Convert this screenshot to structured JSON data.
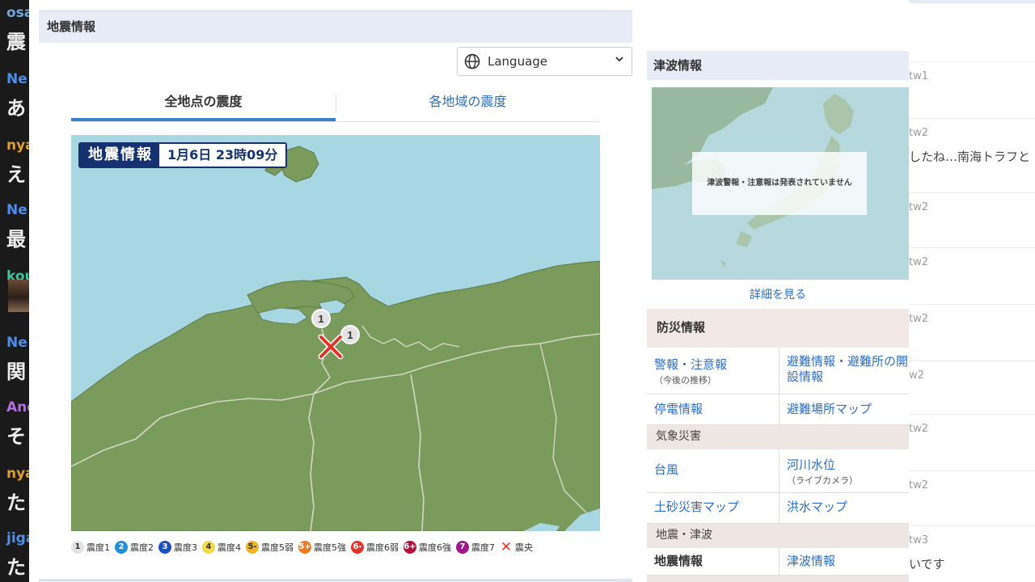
{
  "chat_left": {
    "messages": [
      {
        "name": "osa",
        "text": "震",
        "name_color": "#6fa8dc"
      },
      {
        "name": "Ne",
        "text": "あ",
        "name_color": "#4f8ee8"
      },
      {
        "name": "nya",
        "text": "え",
        "name_color": "#e0a030"
      },
      {
        "name": "Ne",
        "text": "最",
        "name_color": "#4f8ee8"
      },
      {
        "name": "kou",
        "text": "",
        "name_color": "#3cc49a",
        "avatar": true
      },
      {
        "name": "Ne",
        "text": "関",
        "name_color": "#4f8ee8"
      },
      {
        "name": "And",
        "text": "そ",
        "name_color": "#b070e0"
      },
      {
        "name": "nya",
        "text": "た",
        "name_color": "#e0a030"
      },
      {
        "name": "jiga",
        "text": "た",
        "name_color": "#4f8ee8"
      }
    ]
  },
  "chat_right": {
    "messages": [
      {
        "name": "tw1",
        "text": ""
      },
      {
        "name": "tw2",
        "text": "したね…南海トラフと"
      },
      {
        "name": "tw2",
        "text": ""
      },
      {
        "name": "tw2",
        "text": ""
      },
      {
        "name": "tw2",
        "text": ""
      },
      {
        "name": "w2",
        "text": ""
      },
      {
        "name": "tw2",
        "text": ""
      },
      {
        "name": "tw2",
        "text": ""
      },
      {
        "name": "tw3",
        "text": "いです"
      }
    ]
  },
  "main": {
    "header": "地震情報",
    "language_label": "Language",
    "tabs": [
      {
        "label": "全地点の震度",
        "active": true
      },
      {
        "label": "各地域の震度",
        "active": false
      }
    ],
    "map": {
      "badge_title": "地震情報",
      "badge_time": "1月6日 23時09分",
      "intensity_markers": [
        "1",
        "1"
      ],
      "colors": {
        "sea": "#a7d7e3",
        "land": "#7a9b5c",
        "border": "#d6d6c2",
        "epicenter": "#e0352b"
      }
    },
    "legend": [
      {
        "code": "1",
        "label": "震度1",
        "color": "#e3e3e3",
        "text_color": "#333333"
      },
      {
        "code": "2",
        "label": "震度2",
        "color": "#1f8fd8",
        "text_color": "#ffffff"
      },
      {
        "code": "3",
        "label": "震度3",
        "color": "#1d4fc2",
        "text_color": "#ffffff"
      },
      {
        "code": "4",
        "label": "震度4",
        "color": "#f2d84a",
        "text_color": "#333333"
      },
      {
        "code": "5-",
        "label": "震度5弱",
        "color": "#f0b323",
        "text_color": "#333333"
      },
      {
        "code": "5+",
        "label": "震度5強",
        "color": "#ec7a1e",
        "text_color": "#ffffff"
      },
      {
        "code": "6-",
        "label": "震度6弱",
        "color": "#e0352b",
        "text_color": "#ffffff"
      },
      {
        "code": "6+",
        "label": "震度6強",
        "color": "#b3123e",
        "text_color": "#ffffff"
      },
      {
        "code": "7",
        "label": "震度7",
        "color": "#a0168a",
        "text_color": "#ffffff"
      },
      {
        "code": "✕",
        "label": "震央",
        "color": "#e0352b",
        "text_color": "#e0352b"
      }
    ]
  },
  "side": {
    "tsunami_header": "津波情報",
    "tsunami_message": "津波警報・注意報は発表されていません",
    "detail_link": "詳細を見る",
    "bousai_header": "防災情報",
    "cells": {
      "warning": "警報・注意報",
      "warning_sub": "（今後の推移）",
      "evac": "避難情報・避難所の開設情報",
      "power": "停電情報",
      "evac_map": "避難場所マップ",
      "weather_group": "気象災害",
      "typhoon": "台風",
      "river": "河川水位",
      "river_sub": "（ライブカメラ）",
      "landslide": "土砂災害マップ",
      "flood": "洪水マップ",
      "quake_group": "地震・津波",
      "quake_info": "地震情報",
      "tsunami_info": "津波情報"
    }
  }
}
